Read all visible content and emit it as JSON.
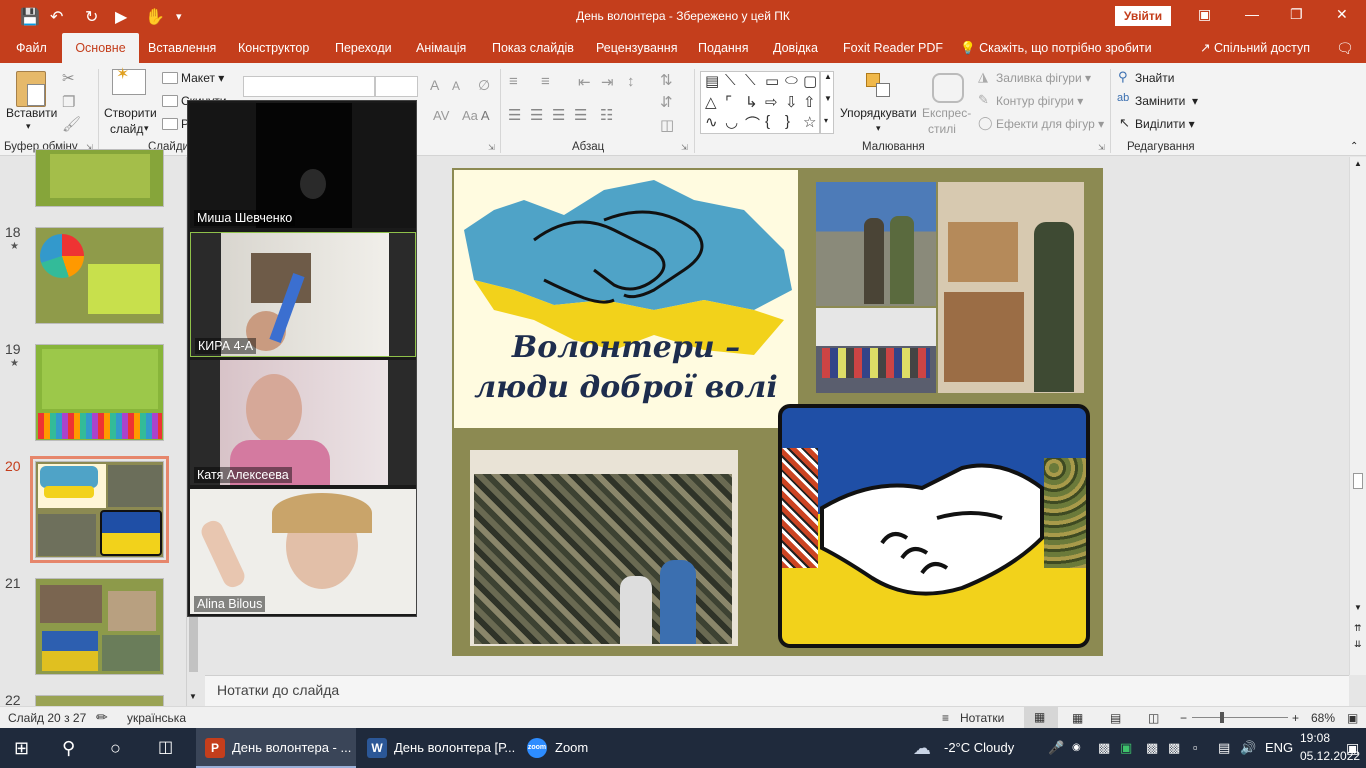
{
  "window": {
    "title": "День волонтера  -  Збережено у цей ПК",
    "sign_in": "Увійти"
  },
  "tabs": [
    "Файл",
    "Основне",
    "Вставлення",
    "Конструктор",
    "Переходи",
    "Анімація",
    "Показ слайдів",
    "Рецензування",
    "Подання",
    "Довідка",
    "Foxit Reader PDF"
  ],
  "tell_me": "Скажіть, що потрібно зробити",
  "share": "Спільний доступ",
  "ribbon": {
    "paste": "Вставити",
    "clipboard_group": "Буфер обміну",
    "new_slide": "Створити",
    "new_slide_2": "слайд",
    "layout": "Макет",
    "reset": "Скинути",
    "section": "Р",
    "slides_group": "Слайди",
    "paragraph_group": "Абзац",
    "arrange": "Упорядкувати",
    "quick_styles": "Експрес-",
    "quick_styles_2": "стилі",
    "shape_fill": "Заливка фігури",
    "shape_outline": "Контур фігури",
    "shape_effects": "Ефекти для фігур",
    "drawing_group": "Малювання",
    "find": "Знайти",
    "replace": "Замінити",
    "select": "Виділити",
    "editing_group": "Редагування"
  },
  "thumbnails": [
    {
      "num": "18",
      "star": "★"
    },
    {
      "num": "19",
      "star": "★"
    },
    {
      "num": "20",
      "star": ""
    },
    {
      "num": "21",
      "star": ""
    },
    {
      "num": "22",
      "star": ""
    }
  ],
  "zoom_participants": [
    "Миша Шевченко",
    "КИРА 4-А",
    "Катя Алексеева",
    "Alina Bilous"
  ],
  "slide": {
    "title_line1": "Волонтери –",
    "title_line2": "люди доброї волі",
    "colors": {
      "blue": "#4fa3c7",
      "yellow": "#f2d21b",
      "flag_blue": "#1f4fa6"
    }
  },
  "notes_placeholder": "Нотатки до слайда",
  "status": {
    "slide_counter": "Слайд 20 з 27",
    "language": "українська",
    "notes_btn": "Нотатки",
    "zoom": "68%"
  },
  "taskbar": {
    "app1": "День волонтера - ...",
    "app2": "День волонтера [Р...",
    "app3": "Zoom",
    "weather": "-2°C  Cloudy",
    "lang": "ENG",
    "time": "19:08",
    "date": "05.12.2022"
  }
}
